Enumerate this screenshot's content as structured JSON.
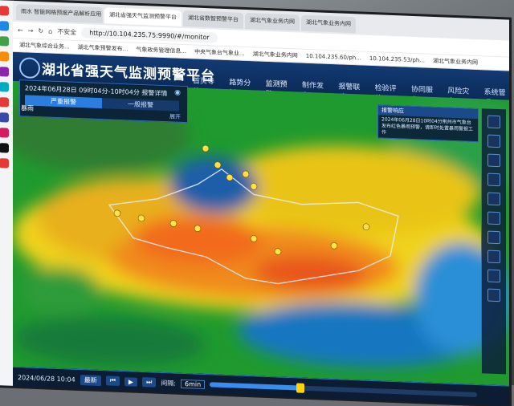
{
  "browser": {
    "tabs": [
      "雨水 智能网格预报产品解析应用",
      "湖北省强天气监测预警平台",
      "湖北省数智预警平台",
      "湖北气象业务内网",
      "湖北气象业务内网"
    ],
    "address_prefix": "不安全",
    "url": "http://10.104.235.75:9990/#/monitor",
    "bookmarks": [
      "湖北气象综合业务...",
      "湖北气象预警发布...",
      "气象政务管理信息...",
      "中央气象台气象业...",
      "湖北气象业务内网",
      "10.104.235.60/ph...",
      "10.104.235.53/ph...",
      "湖北气象业务内网"
    ]
  },
  "app": {
    "title": "湖北省强天气监测预警平台",
    "nav": [
      "首页导航",
      "路势分析",
      "监测预警",
      "制作发布",
      "报警联动",
      "检验评估",
      "协同服务",
      "风险灾害",
      "系统管理"
    ],
    "active_nav": "监测预警"
  },
  "left_panel": {
    "time": "2024年06月28日 09时04分-10时04分 报警详情",
    "tab_severe": "严重报警",
    "tab_general": "一般报警",
    "expand": "展开",
    "rain_label": "暴雨"
  },
  "alert_box": {
    "header": "报警响应",
    "text": "2024年06月28日10时04分荆州市气象台发布红色暴雨预警，请即时处置暴雨警报工作"
  },
  "timebar": {
    "latest_label": "最新",
    "interval_label": "间隔:",
    "interval_value": "6min",
    "progress": 0.34,
    "timestamp": "2024/06/28 10:04"
  },
  "colors": {
    "header": "#123a73",
    "accent": "#2a7de1"
  }
}
